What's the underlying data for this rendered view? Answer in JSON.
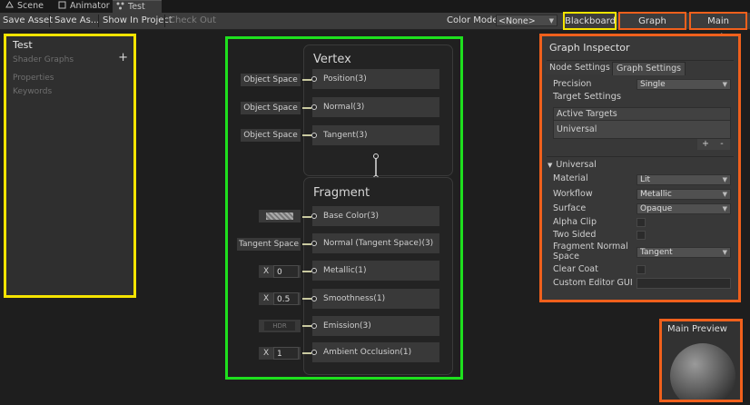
{
  "tabs": [
    {
      "label": "Scene",
      "icon": "scene-icon"
    },
    {
      "label": "Animator",
      "icon": "animator-icon"
    },
    {
      "label": "Test",
      "icon": "shader-graph-icon"
    }
  ],
  "toolbar": {
    "save_asset": "Save Asset",
    "save_as": "Save As...",
    "show_in_project": "Show In Project",
    "check_out": "Check Out",
    "color_mode_label": "Color Mode",
    "color_mode_value": "<None>",
    "blackboard": "Blackboard",
    "graph_inspector": "Graph Inspector",
    "main_preview": "Main Preview"
  },
  "blackboard": {
    "title": "Test",
    "subtitle": "Shader Graphs",
    "properties": "Properties",
    "keywords": "Keywords"
  },
  "vertex": {
    "title": "Vertex",
    "ports": [
      {
        "label": "Position(3)",
        "input": "Object Space"
      },
      {
        "label": "Normal(3)",
        "input": "Object Space"
      },
      {
        "label": "Tangent(3)",
        "input": "Object Space"
      }
    ]
  },
  "fragment": {
    "title": "Fragment",
    "base_color": {
      "label": "Base Color(3)"
    },
    "normal": {
      "label": "Normal (Tangent Space)(3)",
      "input": "Tangent Space"
    },
    "metallic": {
      "label": "Metallic(1)",
      "axis": "X",
      "value": "0"
    },
    "smoothness": {
      "label": "Smoothness(1)",
      "axis": "X",
      "value": "0.5"
    },
    "emission": {
      "label": "Emission(3)",
      "input": "HDR"
    },
    "ambient_occlusion": {
      "label": "Ambient Occlusion(1)",
      "axis": "X",
      "value": "1"
    }
  },
  "inspector": {
    "title": "Graph Inspector",
    "tab_node": "Node Settings",
    "tab_graph": "Graph Settings",
    "precision_label": "Precision",
    "precision_value": "Single",
    "target_settings": "Target Settings",
    "active_targets": "Active Targets",
    "target_item": "Universal",
    "add": "+",
    "remove": "-",
    "universal_header": "Universal",
    "material_label": "Material",
    "material_value": "Lit",
    "workflow_label": "Workflow",
    "workflow_value": "Metallic",
    "surface_label": "Surface",
    "surface_value": "Opaque",
    "alpha_clip_label": "Alpha Clip",
    "two_sided_label": "Two Sided",
    "fragment_normal_label_1": "Fragment Normal",
    "fragment_normal_label_2": "Space",
    "fragment_normal_value": "Tangent",
    "clear_coat_label": "Clear Coat",
    "custom_editor_label": "Custom Editor GUI",
    "custom_editor_value": ""
  },
  "preview": {
    "title": "Main Preview"
  },
  "colors": {
    "blackboard_highlight": "#f5e400",
    "graph_highlight": "#1ee01e",
    "inspector_highlight": "#f0601c",
    "port_wire": "#c9c9a0"
  }
}
